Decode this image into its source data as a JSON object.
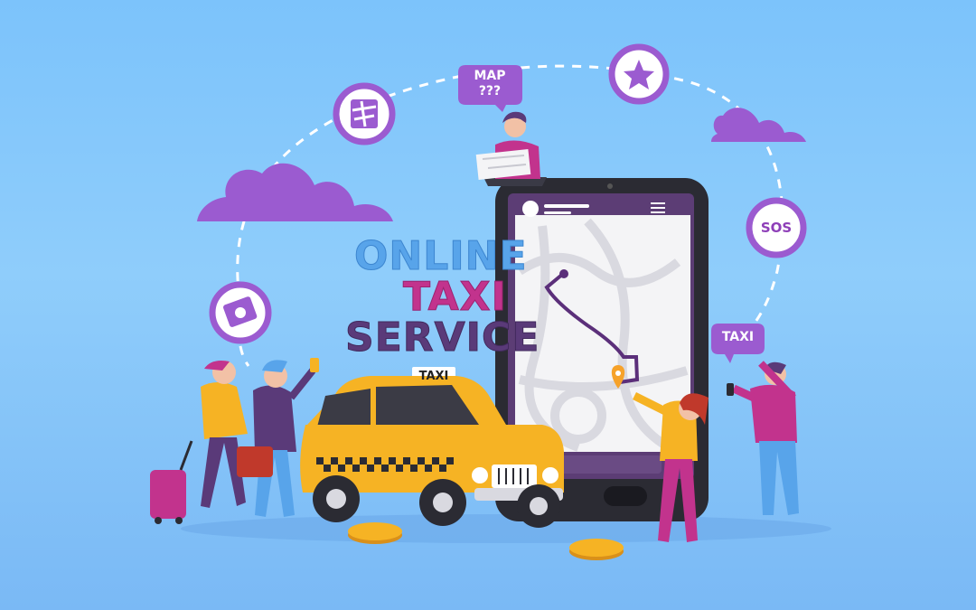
{
  "headline": {
    "line1": "ONLINE",
    "line2": "TAXI",
    "line3": "SERVICE"
  },
  "bubbles": {
    "map_line1": "MAP",
    "map_line2": "???",
    "sos": "SOS",
    "taxi_sign": "TAXI",
    "taxi_roof": "TAXI"
  },
  "icons": [
    "map-icon",
    "star-icon",
    "money-icon",
    "sos-icon",
    "cloud-icon",
    "coin-icon",
    "location-pin-icon"
  ],
  "colors": {
    "background": "#7cc3fb",
    "purple": "#9b5bd0",
    "magenta": "#c2338d",
    "taxi_yellow": "#f6b324",
    "phone_body": "#2b2b33",
    "route": "#5b2f7a",
    "pin": "#f6a22a"
  }
}
